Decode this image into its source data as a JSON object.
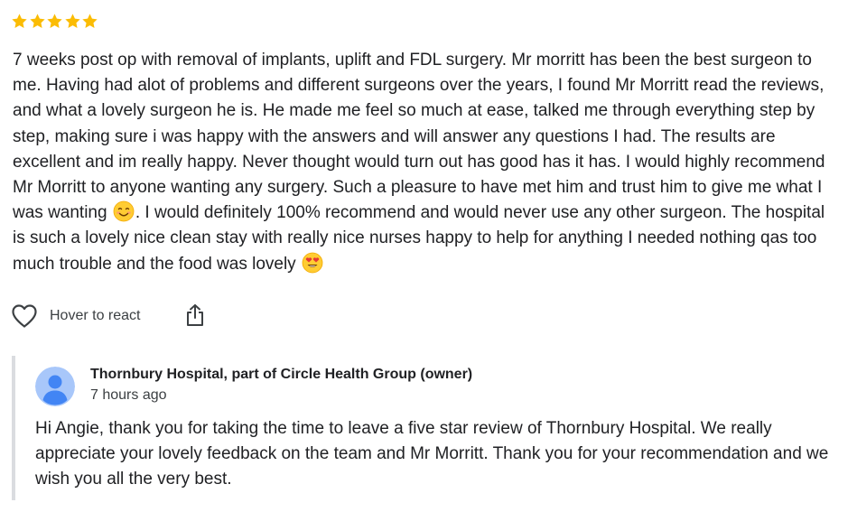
{
  "review": {
    "rating": 5,
    "star_color": "#fbbc04",
    "text_part1": "7 weeks post op with removal of implants, uplift and FDL surgery. Mr morritt has been the best surgeon to me. Having had alot of problems and different surgeons over the years, I found Mr Morritt read the reviews, and what a lovely surgeon he is. He made me feel so much at ease, talked me through everything step by step, making sure i was happy with the answers and will answer any questions I had. The results are excellent and im really happy. Never thought would turn out has good has it has. I would highly recommend Mr Morritt to anyone wanting any surgery. Such a pleasure to have met him and trust him to give me what I was wanting ",
    "emoji1": "smiling-face-icon",
    "text_part2": ". I would definitely 100% recommend and would never use any other surgeon. The hospital is such a lovely nice clean stay with really nice nurses happy to help for anything I needed nothing qas too much trouble and the food was lovely ",
    "emoji2": "heart-eyes-face-icon"
  },
  "actions": {
    "react_icon": "heart-outline-icon",
    "react_label": "Hover to react",
    "share_icon": "share-icon"
  },
  "owner_reply": {
    "avatar_icon": "person-avatar-icon",
    "owner_name": "Thornbury Hospital, part of Circle Health Group (owner)",
    "time": "7 hours ago",
    "text": "Hi Angie, thank you for taking the time to leave a five star review of Thornbury Hospital. We really appreciate your lovely feedback on the team and Mr Morritt. Thank you for your recommendation and we wish you all the very best."
  }
}
